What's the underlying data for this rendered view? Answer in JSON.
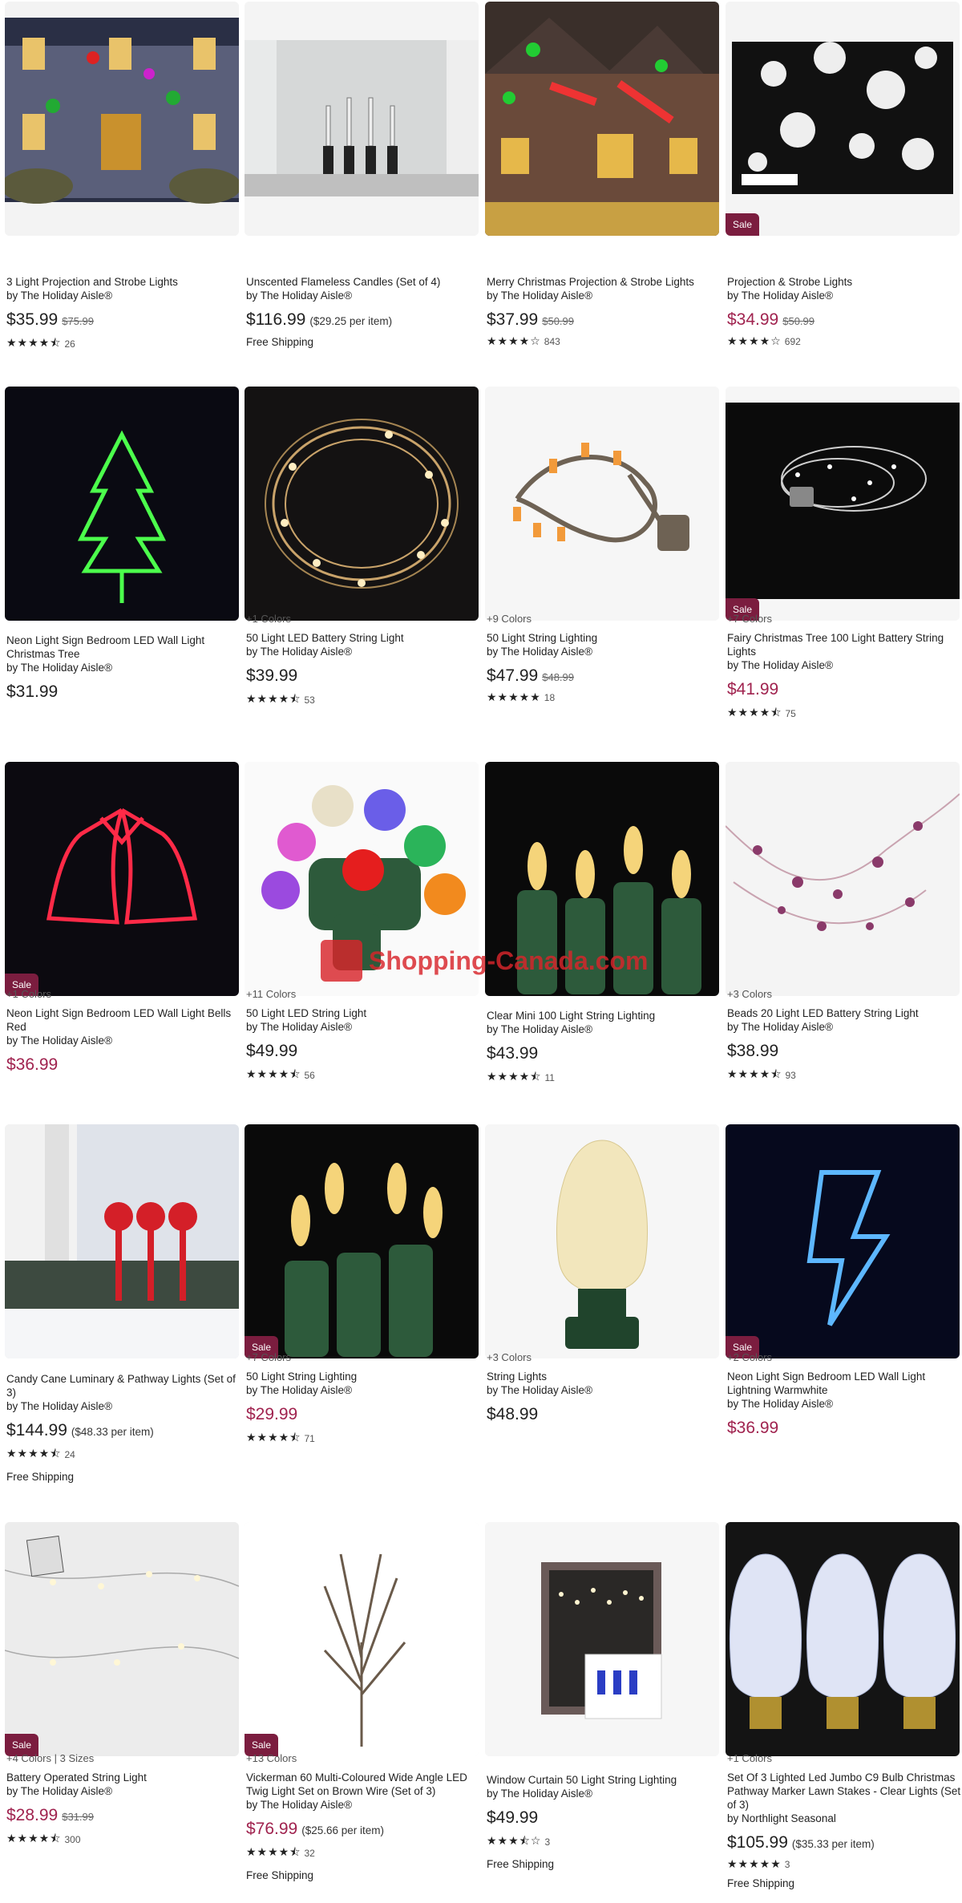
{
  "products": [
    {
      "title": "3 Light Projection and Strobe Lights",
      "by": "by The Holiday Aisle®",
      "price": "$35.99",
      "orig": "$75.99",
      "stars": "★★★★⯪",
      "rating_count": "26",
      "sale": false
    },
    {
      "title": "Unscented Flameless Candles (Set of 4)",
      "by": "by The Holiday Aisle®",
      "price": "$116.99",
      "per_item": "($29.25 per item)",
      "shipping": "Free Shipping",
      "sale": false
    },
    {
      "title": "Merry Christmas Projection & Strobe Lights",
      "by": "by The Holiday Aisle®",
      "price": "$37.99",
      "orig": "$50.99",
      "stars": "★★★★☆",
      "rating_count": "843",
      "sale": false
    },
    {
      "title": "Projection & Strobe Lights",
      "by": "by The Holiday Aisle®",
      "price": "$34.99",
      "orig": "$50.99",
      "stars": "★★★★☆",
      "rating_count": "692",
      "sale": true
    },
    {
      "title": "Neon Light Sign Bedroom LED Wall Light Christmas Tree",
      "by": "by The Holiday Aisle®",
      "price": "$31.99",
      "sale": false
    },
    {
      "colors": "+1 Colors",
      "title": "50 Light LED Battery String Light",
      "by": "by The Holiday Aisle®",
      "price": "$39.99",
      "stars": "★★★★⯪",
      "rating_count": "53",
      "sale": false
    },
    {
      "colors": "+9 Colors",
      "title": "50 Light String Lighting",
      "by": "by The Holiday Aisle®",
      "price": "$47.99",
      "orig": "$48.99",
      "stars": "★★★★★",
      "rating_count": "18",
      "sale": false
    },
    {
      "colors": "+7 Colors",
      "title": "Fairy Christmas Tree 100 Light Battery String Lights",
      "by": "by The Holiday Aisle®",
      "price": "$41.99",
      "stars": "★★★★⯪",
      "rating_count": "75",
      "sale": true
    },
    {
      "colors": "+1 Colors",
      "title": "Neon Light Sign Bedroom LED Wall Light Bells Red",
      "by": "by The Holiday Aisle®",
      "price": "$36.99",
      "sale": true
    },
    {
      "colors": "+11 Colors",
      "title": "50 Light LED String Light",
      "by": "by The Holiday Aisle®",
      "price": "$49.99",
      "stars": "★★★★⯪",
      "rating_count": "56",
      "sale": false
    },
    {
      "title": "Clear Mini 100 Light String Lighting",
      "by": "by The Holiday Aisle®",
      "price": "$43.99",
      "stars": "★★★★⯪",
      "rating_count": "11",
      "sale": false
    },
    {
      "colors": "+3 Colors",
      "title": "Beads 20 Light LED Battery String Light",
      "by": "by The Holiday Aisle®",
      "price": "$38.99",
      "stars": "★★★★⯪",
      "rating_count": "93",
      "sale": false
    },
    {
      "title": "Candy Cane Luminary & Pathway Lights (Set of 3)",
      "by": "by The Holiday Aisle®",
      "price": "$144.99",
      "per_item": "($48.33 per item)",
      "stars": "★★★★⯪",
      "rating_count": "24",
      "shipping": "Free Shipping",
      "sale": false
    },
    {
      "colors": "+7 Colors",
      "title": "50 Light String Lighting",
      "by": "by The Holiday Aisle®",
      "price": "$29.99",
      "stars": "★★★★⯪",
      "rating_count": "71",
      "sale": true
    },
    {
      "colors": "+3 Colors",
      "title": "String Lights",
      "by": "by The Holiday Aisle®",
      "price": "$48.99",
      "sale": false
    },
    {
      "colors": "+2 Colors",
      "title": "Neon Light Sign Bedroom LED Wall Light Lightning Warmwhite",
      "by": "by The Holiday Aisle®",
      "price": "$36.99",
      "sale": true
    },
    {
      "colors": "+4 Colors | 3 Sizes",
      "title": "Battery Operated String Light",
      "by": "by The Holiday Aisle®",
      "price": "$28.99",
      "orig": "$31.99",
      "stars": "★★★★⯪",
      "rating_count": "300",
      "sale": true
    },
    {
      "colors": "+13 Colors",
      "title": "Vickerman 60 Multi-Coloured Wide Angle LED Twig Light Set on Brown Wire (Set of 3)",
      "by": "by The Holiday Aisle®",
      "price": "$76.99",
      "per_item": "($25.66 per item)",
      "stars": "★★★★⯪",
      "rating_count": "32",
      "shipping": "Free Shipping",
      "sale": true
    },
    {
      "title": "Window Curtain 50 Light String Lighting",
      "by": "by The Holiday Aisle®",
      "price": "$49.99",
      "stars": "★★★⯪☆",
      "rating_count": "3",
      "shipping": "Free Shipping",
      "sale": false
    },
    {
      "colors": "+1 Colors",
      "title": "Set Of 3 Lighted Led Jumbo C9 Bulb Christmas Pathway Marker Lawn Stakes - Clear Lights (Set of 3)",
      "by": "by Northlight Seasonal",
      "price": "$105.99",
      "per_item": "($35.33 per item)",
      "stars": "★★★★★",
      "rating_count": "3",
      "shipping": "Free Shipping",
      "sale": false
    }
  ],
  "sale_label": "Sale",
  "watermark": "Shopping-Canada.com",
  "colors": {
    "sale_badge": "#7b1d3f",
    "sale_price": "#a0234f"
  }
}
